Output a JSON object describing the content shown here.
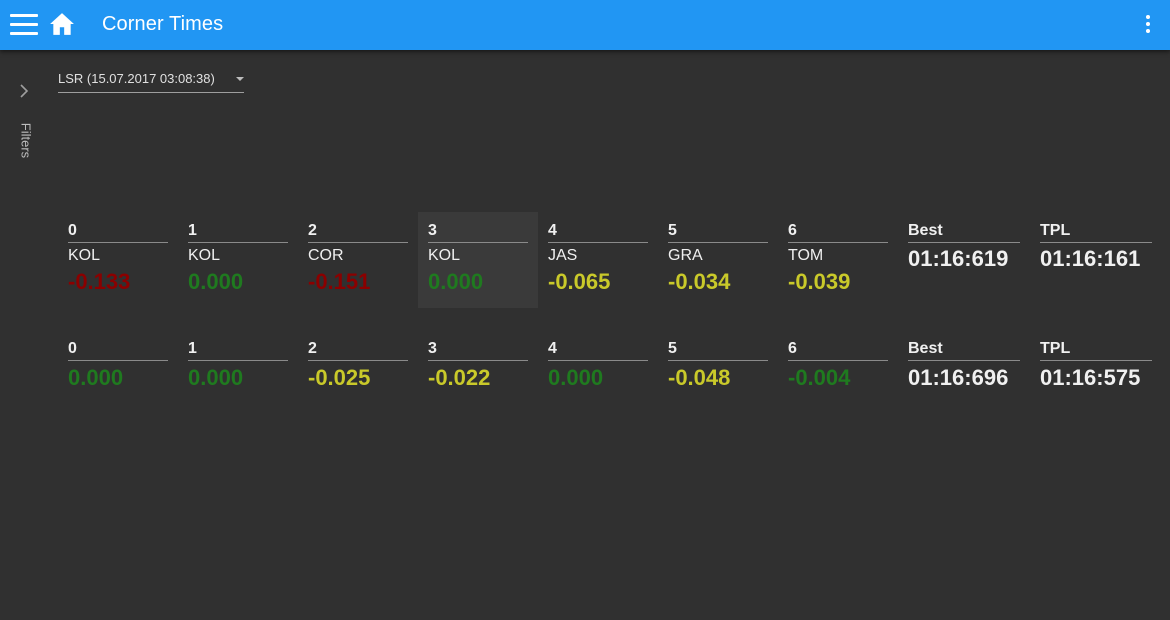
{
  "app": {
    "title": "Corner Times"
  },
  "filters": {
    "label": "Filters"
  },
  "session": {
    "selected": "LSR (15.07.2017 03:08:38)"
  },
  "rows": [
    {
      "corners": [
        {
          "index": "0",
          "driver": "KOL",
          "value": "-0.133",
          "color": "red"
        },
        {
          "index": "1",
          "driver": "KOL",
          "value": "0.000",
          "color": "green"
        },
        {
          "index": "2",
          "driver": "COR",
          "value": "-0.151",
          "color": "red"
        },
        {
          "index": "3",
          "driver": "KOL",
          "value": "0.000",
          "color": "green",
          "highlighted": true
        },
        {
          "index": "4",
          "driver": "JAS",
          "value": "-0.065",
          "color": "yellow"
        },
        {
          "index": "5",
          "driver": "GRA",
          "value": "-0.034",
          "color": "yellow"
        },
        {
          "index": "6",
          "driver": "TOM",
          "value": "-0.039",
          "color": "yellow"
        }
      ],
      "best": {
        "label": "Best",
        "value": "01:16:619"
      },
      "tpl": {
        "label": "TPL",
        "value": "01:16:161"
      }
    },
    {
      "corners": [
        {
          "index": "0",
          "value": "0.000",
          "color": "green"
        },
        {
          "index": "1",
          "value": "0.000",
          "color": "green"
        },
        {
          "index": "2",
          "value": "-0.025",
          "color": "yellow"
        },
        {
          "index": "3",
          "value": "-0.022",
          "color": "yellow"
        },
        {
          "index": "4",
          "value": "0.000",
          "color": "green"
        },
        {
          "index": "5",
          "value": "-0.048",
          "color": "yellow"
        },
        {
          "index": "6",
          "value": "-0.004",
          "color": "green"
        }
      ],
      "best": {
        "label": "Best",
        "value": "01:16:696"
      },
      "tpl": {
        "label": "TPL",
        "value": "01:16:575"
      }
    }
  ],
  "colors": {
    "appbar": "#2196f3",
    "background": "#303030",
    "red": "#8b0000",
    "green": "#1f7a1f",
    "yellow": "#c9c92a"
  }
}
